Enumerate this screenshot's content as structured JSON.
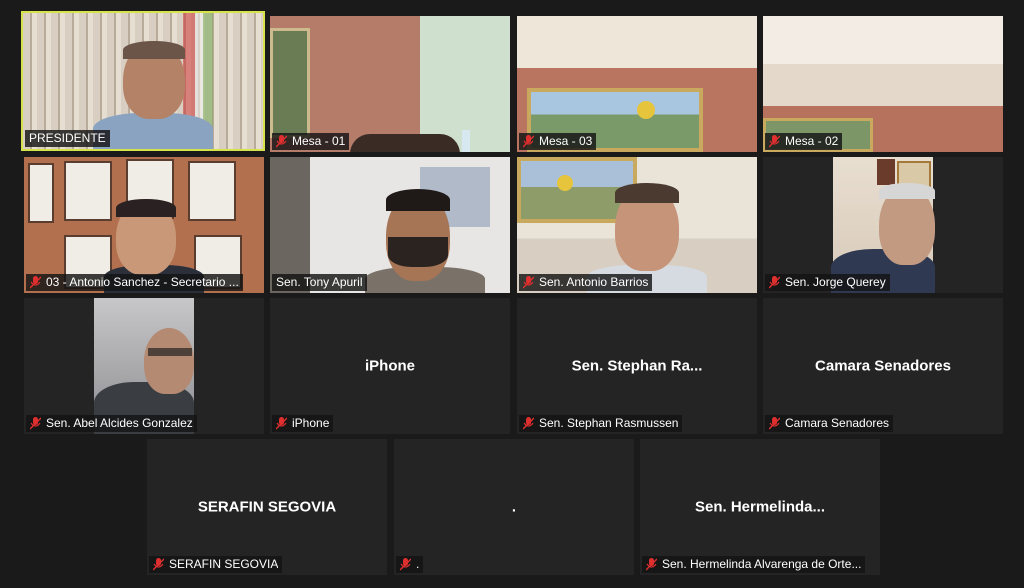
{
  "tiles": [
    {
      "label": "PRESIDENTE",
      "muted": false,
      "active": true
    },
    {
      "label": "Mesa - 01",
      "muted": true
    },
    {
      "label": "Mesa - 03",
      "muted": true
    },
    {
      "label": "Mesa - 02",
      "muted": true
    },
    {
      "label": "03 - Antonio Sanchez - Secretario ...",
      "muted": true
    },
    {
      "label": "Sen. Tony Apuril",
      "muted": false
    },
    {
      "label": "Sen. Antonio Barrios",
      "muted": true
    },
    {
      "label": "Sen. Jorge Querey",
      "muted": true
    },
    {
      "label": "Sen. Abel Alcides Gonzalez",
      "muted": true
    },
    {
      "label": "iPhone",
      "muted": true,
      "display_name": "iPhone"
    },
    {
      "label": "Sen. Stephan Rasmussen",
      "muted": true,
      "display_name": "Sen.  Stephan Ra..."
    },
    {
      "label": "Camara Senadores",
      "muted": true,
      "display_name": "Camara Senadores"
    },
    {
      "label": "SERAFIN SEGOVIA",
      "muted": true,
      "display_name": "SERAFIN SEGOVIA"
    },
    {
      "label": ".",
      "muted": true,
      "display_name": "."
    },
    {
      "label": "Sen. Hermelinda Alvarenga de Orte...",
      "muted": true,
      "display_name": "Sen.  Hermelinda..."
    }
  ],
  "colors": {
    "background": "#1a1a1a",
    "tile": "#242424",
    "active_speaker_border": "#d7e34a",
    "muted_icon": "#e02f2f"
  }
}
